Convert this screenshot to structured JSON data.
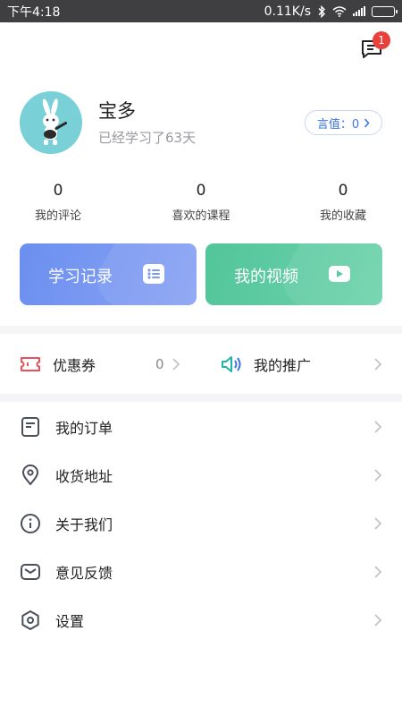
{
  "status_bar": {
    "time": "下午4:18",
    "network_speed": "0.11K/s",
    "icons": [
      "bluetooth-icon",
      "wifi-icon",
      "signal-icon",
      "battery-icon"
    ]
  },
  "header": {
    "message_badge": "1"
  },
  "profile": {
    "name": "宝多",
    "study_days_text": "已经学习了63天",
    "yanzhi_label": "言值：0"
  },
  "stats": [
    {
      "value": "0",
      "label": "我的评论"
    },
    {
      "value": "0",
      "label": "喜欢的课程"
    },
    {
      "value": "0",
      "label": "我的收藏"
    }
  ],
  "cards": {
    "study_record": "学习记录",
    "my_videos": "我的视频"
  },
  "quick_row": {
    "coupon_label": "优惠券",
    "coupon_count": "0",
    "promotion_label": "我的推广"
  },
  "menu": [
    {
      "label": "我的订单",
      "icon": "order-icon"
    },
    {
      "label": "收货地址",
      "icon": "location-pin-icon"
    },
    {
      "label": "关于我们",
      "icon": "info-icon"
    },
    {
      "label": "意见反馈",
      "icon": "mail-icon"
    },
    {
      "label": "设置",
      "icon": "settings-icon"
    }
  ],
  "colors": {
    "accent_blue": "#6b8ff0",
    "accent_green": "#52c59a",
    "badge_red": "#e8413b",
    "coupon_red": "#e8505b",
    "promo_teal": "#1fb5a5",
    "yanzhi_text": "#3d74e6"
  }
}
